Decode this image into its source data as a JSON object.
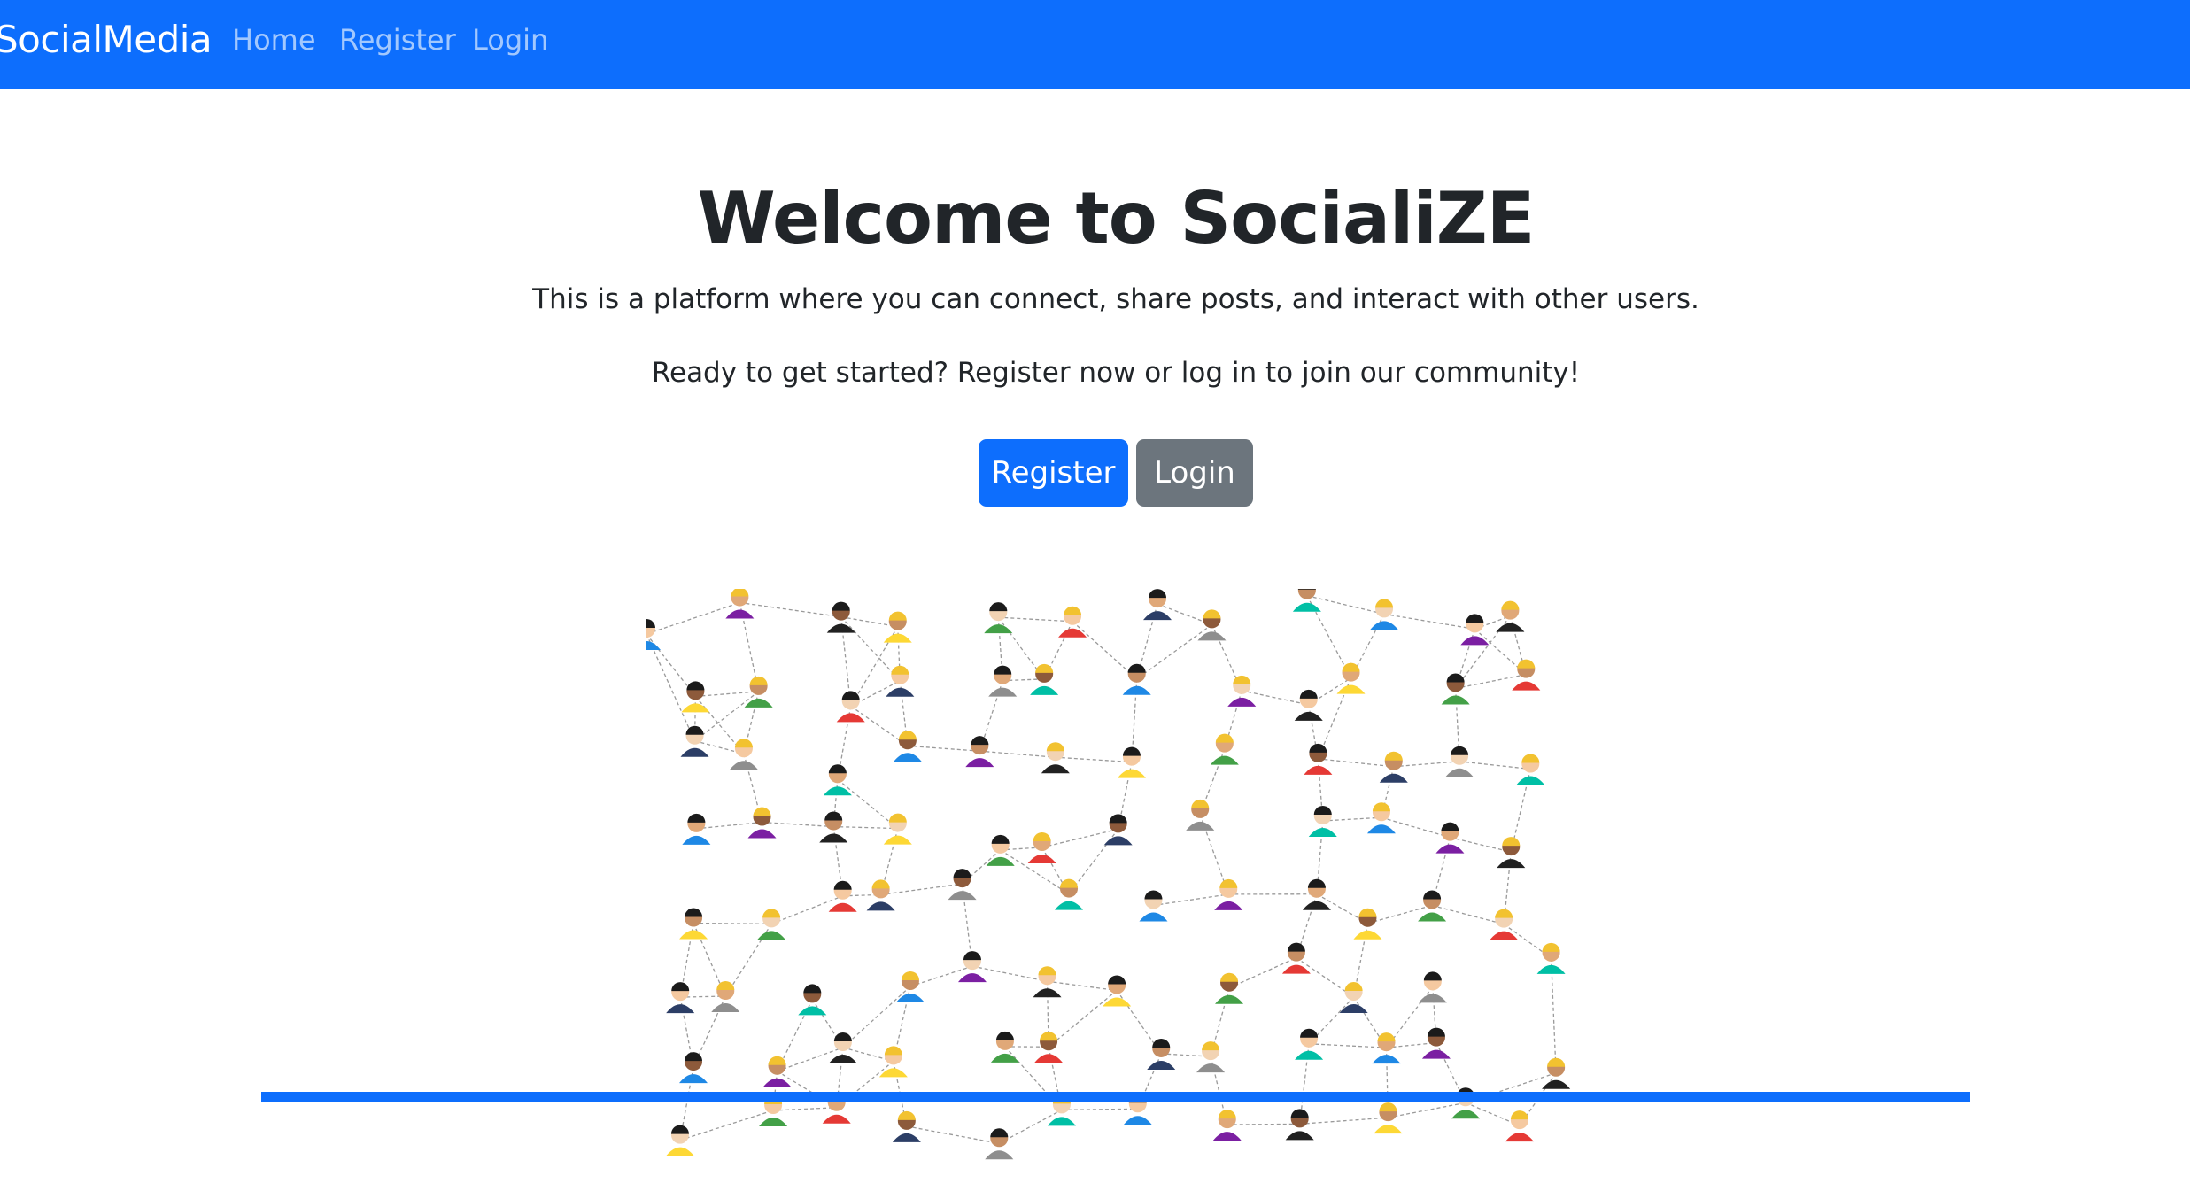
{
  "navbar": {
    "brand": "SocialMedia",
    "links": [
      {
        "label": "Home"
      },
      {
        "label": "Register"
      },
      {
        "label": "Login"
      }
    ]
  },
  "hero": {
    "title": "Welcome to SocialiZE",
    "subtitle": "This is a platform where you can connect, share posts, and interact with other users.",
    "cta_text": "Ready to get started? Register now or log in to join our community!",
    "register_button": "Register",
    "login_button": "Login"
  },
  "illustration": {
    "icon": "people-network-illustration"
  },
  "colors": {
    "primary": "#0d6efd",
    "secondary": "#6c757d",
    "text": "#212529",
    "background": "#ffffff"
  }
}
